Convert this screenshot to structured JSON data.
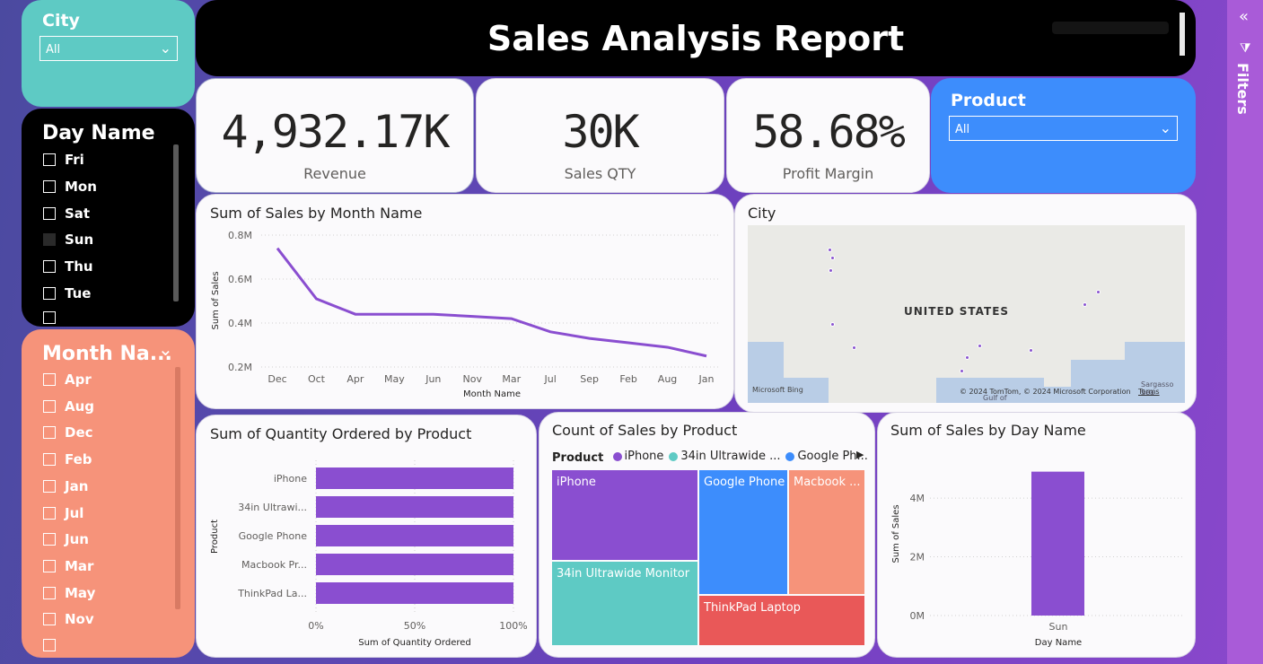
{
  "header": {
    "title": "Sales Analysis Report"
  },
  "city_slicer": {
    "title": "City",
    "value": "All"
  },
  "day_slicer": {
    "title": "Day Name",
    "items": [
      {
        "label": "Fri",
        "checked": false
      },
      {
        "label": "Mon",
        "checked": false
      },
      {
        "label": "Sat",
        "checked": false
      },
      {
        "label": "Sun",
        "checked": true
      },
      {
        "label": "Thu",
        "checked": false
      },
      {
        "label": "Tue",
        "checked": false
      }
    ]
  },
  "month_slicer": {
    "title": "Month Na...",
    "items": [
      "Apr",
      "Aug",
      "Dec",
      "Feb",
      "Jan",
      "Jul",
      "Jun",
      "Mar",
      "May",
      "Nov"
    ]
  },
  "kpis": {
    "revenue": {
      "value": "4,932.17K",
      "label": "Revenue"
    },
    "qty": {
      "value": "30K",
      "label": "Sales QTY"
    },
    "margin": {
      "value": "58.68%",
      "label": "Profit Margin"
    }
  },
  "product_slicer": {
    "title": "Product",
    "value": "All"
  },
  "charts_text": {
    "month_chart_title": "Sum of Sales by Month Name",
    "map_title": "City",
    "qty_chart_title": "Sum of Quantity Ordered by Product",
    "treemap_title": "Count of Sales by Product",
    "day_chart_title": "Sum of Sales by Day Name",
    "map_country": "UNITED STATES",
    "map_copyright": "© 2024 TomTom, © 2024 Microsoft Corporation",
    "map_terms": "Terms",
    "map_brand": "Microsoft Bing",
    "map_sea": "Sargasso Sea",
    "map_gulf": "Gulf of",
    "treemap_legend_label": "Product"
  },
  "filters_pane": {
    "label": "Filters"
  },
  "colors": {
    "purple": "#8a4ed0",
    "teal": "#5ecac4",
    "blue": "#3d8dfc",
    "salmon": "#f6937a",
    "red": "#e95858"
  },
  "chart_data": [
    {
      "type": "line",
      "title": "Sum of Sales by Month Name",
      "xlabel": "Month Name",
      "ylabel": "Sum of Sales",
      "categories": [
        "Dec",
        "Oct",
        "Apr",
        "May",
        "Jun",
        "Nov",
        "Mar",
        "Jul",
        "Sep",
        "Feb",
        "Aug",
        "Jan"
      ],
      "values": [
        0.74,
        0.51,
        0.44,
        0.44,
        0.44,
        0.43,
        0.42,
        0.36,
        0.33,
        0.31,
        0.29,
        0.25
      ],
      "y_ticks": [
        "0.2M",
        "0.4M",
        "0.6M",
        "0.8M"
      ],
      "ylim": [
        0.2,
        0.8
      ]
    },
    {
      "type": "bar",
      "orientation": "horizontal",
      "title": "Sum of Quantity Ordered by Product",
      "xlabel": "Sum of Quantity Ordered",
      "ylabel": "Product",
      "categories": [
        "iPhone",
        "34in Ultrawi...",
        "Google Phone",
        "Macbook Pr...",
        "ThinkPad La..."
      ],
      "values": [
        100,
        100,
        100,
        100,
        100
      ],
      "x_ticks": [
        "0%",
        "50%",
        "100%"
      ]
    },
    {
      "type": "treemap",
      "title": "Count of Sales by Product",
      "legend": [
        "iPhone",
        "34in Ultrawide ...",
        "Google Ph..."
      ],
      "tiles": [
        {
          "label": "iPhone",
          "color": "#8a4ed0"
        },
        {
          "label": "34in Ultrawide Monitor",
          "color": "#5ecac4"
        },
        {
          "label": "Google Phone",
          "color": "#3d8dfc"
        },
        {
          "label": "Macbook ...",
          "color": "#f6937a"
        },
        {
          "label": "ThinkPad Laptop",
          "color": "#e95858"
        }
      ]
    },
    {
      "type": "bar",
      "title": "Sum of Sales by Day Name",
      "xlabel": "Day Name",
      "ylabel": "Sum of Sales",
      "categories": [
        "Sun"
      ],
      "values": [
        4.9
      ],
      "y_ticks": [
        "0M",
        "2M",
        "4M"
      ],
      "ylim": [
        0,
        5.5
      ]
    }
  ]
}
